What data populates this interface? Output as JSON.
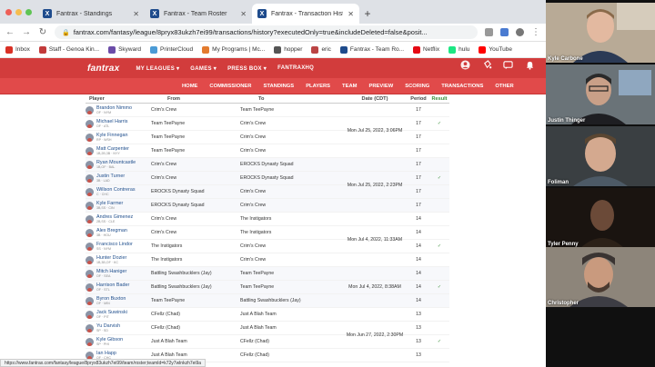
{
  "browser": {
    "tabs": [
      {
        "label": "Fantrax - Standings",
        "active": false
      },
      {
        "label": "Fantrax - Team Roster",
        "active": false
      },
      {
        "label": "Fantrax - Transaction History",
        "active": true
      }
    ],
    "url": "fantrax.com/fantasy/league/8pryx83ukzh7ei99/transactions/history?executedOnly=true&includeDeleted=false&posit...",
    "bookmarks": [
      "Inbox",
      "Staff - Genoa Kin...",
      "Skyward",
      "PrinterCloud",
      "My Programs | Mc...",
      "hopper",
      "eric",
      "Fantrax - Team Ro...",
      "Netflix",
      "hulu",
      "YouTube"
    ],
    "status_url": "https://www.fantrax.com/fantasy/league/8pryx83ukzh7ei99/team/roster;teamId=k72y7wlnkzh7ei9a"
  },
  "site": {
    "logo": "fantrax",
    "top_menu": [
      "MY LEAGUES ▾",
      "GAMES ▾",
      "PRESS BOX ▾",
      "FANTRAXHQ"
    ],
    "sub_menu": [
      "HOME",
      "COMMISSIONER",
      "STANDINGS",
      "PLAYERS",
      "TEAM",
      "PREVIEW",
      "SCORING",
      "TRANSACTIONS",
      "OTHER"
    ]
  },
  "table": {
    "headers": {
      "player": "Player",
      "from": "From",
      "to": "To",
      "date": "Date (CDT)",
      "period": "Period",
      "result": "Result"
    },
    "rows": [
      {
        "name": "Brandon Nimmo",
        "meta": "OF · NYM",
        "from": "Crim's Crew",
        "to": "Team TeePayne",
        "period": "17",
        "result": ""
      },
      {
        "name": "Michael Harris",
        "meta": "OF · ATL",
        "from": "Team TeePayne",
        "to": "Crim's Crew",
        "period": "17",
        "result": "✓"
      },
      {
        "name": "Kyle Finnegan",
        "meta": "RP · WSH",
        "from": "Team TeePayne",
        "to": "Crim's Crew",
        "period": "17",
        "result": ""
      },
      {
        "name": "Matt Carpenter",
        "meta": "1B,2B,3B · NYY",
        "from": "Team TeePayne",
        "to": "Crim's Crew",
        "period": "17",
        "result": ""
      },
      {
        "name": "Ryan Mountcastle",
        "meta": "1B,OF · BAL",
        "from": "Crim's Crew",
        "to": "EROCKS Dynasty Squad",
        "period": "17",
        "result": ""
      },
      {
        "name": "Justin Turner",
        "meta": "3B · LAD",
        "from": "Crim's Crew",
        "to": "EROCKS Dynasty Squad",
        "period": "17",
        "result": "✓"
      },
      {
        "name": "Willson Contreras",
        "meta": "C · CHC",
        "from": "EROCKS Dynasty Squad",
        "to": "Crim's Crew",
        "period": "17",
        "result": ""
      },
      {
        "name": "Kyle Farmer",
        "meta": "3B,SS · CIN",
        "from": "EROCKS Dynasty Squad",
        "to": "Crim's Crew",
        "period": "17",
        "result": ""
      },
      {
        "name": "Andres Gimenez",
        "meta": "2B,SS · CLE",
        "from": "Crim's Crew",
        "to": "The Instigators",
        "period": "14",
        "result": ""
      },
      {
        "name": "Alex Bregman",
        "meta": "3B · HOU",
        "from": "Crim's Crew",
        "to": "The Instigators",
        "period": "14",
        "result": ""
      },
      {
        "name": "Francisco Lindor",
        "meta": "SS · NYM",
        "from": "The Instigators",
        "to": "Crim's Crew",
        "period": "14",
        "result": "✓"
      },
      {
        "name": "Hunter Dozier",
        "meta": "1B,3B,OF · KC",
        "from": "The Instigators",
        "to": "Crim's Crew",
        "period": "14",
        "result": ""
      },
      {
        "name": "Mitch Haniger",
        "meta": "OF · SEA",
        "from": "Battling Swashbucklers (Jay)",
        "to": "Team TeePayne",
        "period": "14",
        "result": ""
      },
      {
        "name": "Harrison Bader",
        "meta": "OF · STL",
        "from": "Battling Swashbucklers (Jay)",
        "to": "Team TeePayne",
        "period": "14",
        "result": "✓"
      },
      {
        "name": "Byron Buxton",
        "meta": "OF · MIN",
        "from": "Team TeePayne",
        "to": "Battling Swashbucklers (Jay)",
        "period": "14",
        "result": ""
      },
      {
        "name": "Jack Suwinski",
        "meta": "OF · PIT",
        "from": "CFellz (Chad)",
        "to": "Just A Blah Team",
        "period": "13",
        "result": ""
      },
      {
        "name": "Yu Darvish",
        "meta": "SP · SD",
        "from": "CFellz (Chad)",
        "to": "Just A Blah Team",
        "period": "13",
        "result": ""
      },
      {
        "name": "Kyle Gibson",
        "meta": "SP · PHI",
        "from": "Just A Blah Team",
        "to": "CFellz (Chad)",
        "period": "13",
        "result": "✓"
      },
      {
        "name": "Ian Happ",
        "meta": "OF · CHC",
        "from": "Just A Blah Team",
        "to": "CFellz (Chad)",
        "period": "13",
        "result": ""
      }
    ],
    "dates": [
      {
        "label": "Mon Jul 25, 2022, 3:06PM"
      },
      {
        "label": "Mon Jul 25, 2022, 2:23PM"
      },
      {
        "label": "Mon Jul 4, 2022, 11:33AM"
      },
      {
        "label": "Mon Jul 4, 2022, 8:38AM"
      },
      {
        "label": "Mon Jun 27, 2022, 2:30PM"
      }
    ]
  },
  "video": {
    "participants": [
      {
        "name": "Kyle Carbone"
      },
      {
        "name": "Justin Thinger"
      },
      {
        "name": "Foliman"
      },
      {
        "name": "Tyler Penny"
      },
      {
        "name": "Christopher"
      }
    ]
  },
  "colors": {
    "fantrax_red": "#d23c3c",
    "fantrax_red_light": "#e14a4a",
    "link_blue": "#1f4e8c",
    "check_green": "#3a8f3a"
  }
}
